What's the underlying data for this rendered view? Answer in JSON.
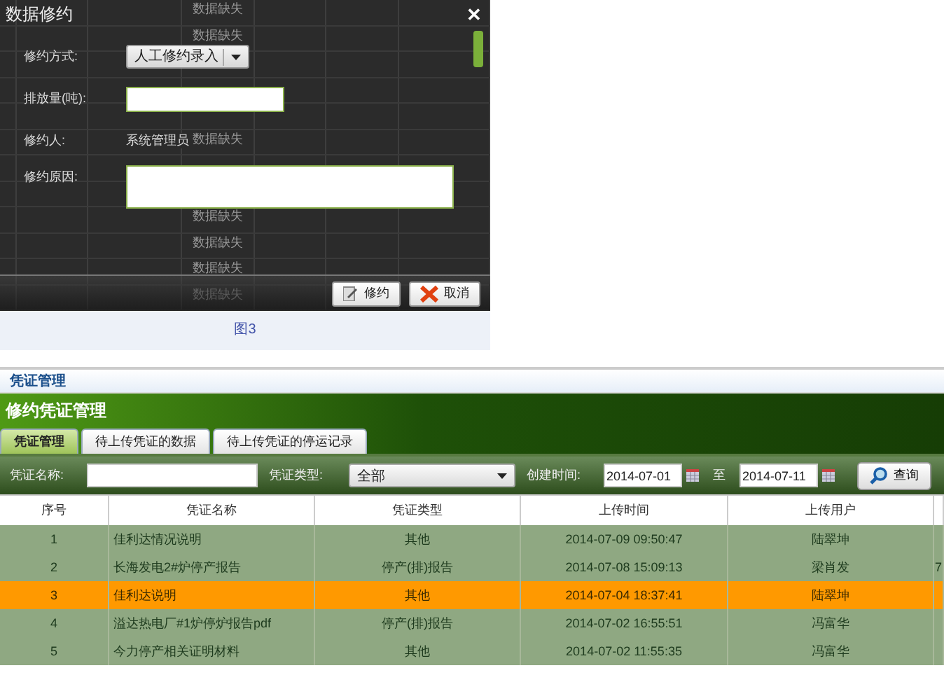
{
  "background_table": {
    "rows": [
      {
        "kind": "data",
        "text": "数据缺失"
      },
      {
        "kind": "data",
        "text": "数据缺失"
      },
      {
        "kind": "blank"
      },
      {
        "kind": "blank"
      },
      {
        "kind": "blank"
      },
      {
        "kind": "data",
        "text": "数据缺失"
      },
      {
        "kind": "blank"
      },
      {
        "kind": "blank"
      },
      {
        "kind": "data",
        "text": "数据缺失"
      },
      {
        "kind": "data",
        "text": "数据缺失"
      },
      {
        "kind": "data",
        "text": "数据缺失"
      },
      {
        "kind": "data",
        "text": "数据缺失"
      }
    ]
  },
  "dialog": {
    "title": "数据修约",
    "close": "✕",
    "fields": [
      {
        "kind": "select",
        "label": "修约方式:",
        "value": "人工修约录入"
      },
      {
        "kind": "input",
        "label": "排放量(吨):"
      },
      {
        "kind": "text",
        "label": "修约人:",
        "value": "系统管理员"
      },
      {
        "kind": "textarea",
        "label": "修约原因:"
      }
    ],
    "buttons": [
      {
        "kind": "edit",
        "label": "修约"
      },
      {
        "kind": "cancel",
        "label": "取消"
      }
    ]
  },
  "caption": "图3",
  "breadcrumb": "凭证管理",
  "panel": {
    "title": "修约凭证管理",
    "tabs": [
      {
        "label": "凭证管理",
        "selected": true
      },
      {
        "label": "待上传凭证的数据",
        "selected": false
      },
      {
        "label": "待上传凭证的停运记录",
        "selected": false
      }
    ],
    "filters": {
      "name_label": "凭证名称:",
      "type_label": "凭证类型:",
      "type_value": "全部",
      "time_label": "创建时间:",
      "date_from": "2014-07-01",
      "to_label": "至",
      "date_to": "2014-07-11",
      "search_button": "查询"
    },
    "table": {
      "columns": [
        "序号",
        "凭证名称",
        "凭证类型",
        "上传时间",
        "上传用户"
      ],
      "rows": [
        {
          "selected": false,
          "cells": [
            "1",
            "佳利达情况说明",
            "其他",
            "2014-07-09 09:50:47",
            "陆翠坤"
          ]
        },
        {
          "selected": false,
          "cells": [
            "2",
            "长海发电2#炉停产报告",
            "停产(排)报告",
            "2014-07-08 15:09:13",
            "梁肖发"
          ],
          "column_6": "7"
        },
        {
          "selected": true,
          "cells": [
            "3",
            "佳利达说明",
            "其他",
            "2014-07-04 18:37:41",
            "陆翠坤"
          ]
        },
        {
          "selected": false,
          "cells": [
            "4",
            "溢达热电厂#1炉停炉报告pdf",
            "停产(排)报告",
            "2014-07-02 16:55:51",
            "冯富华"
          ]
        },
        {
          "selected": false,
          "cells": [
            "5",
            "今力停产相关证明材料",
            "其他",
            "2014-07-02 11:55:35",
            "冯富华"
          ]
        }
      ]
    }
  }
}
